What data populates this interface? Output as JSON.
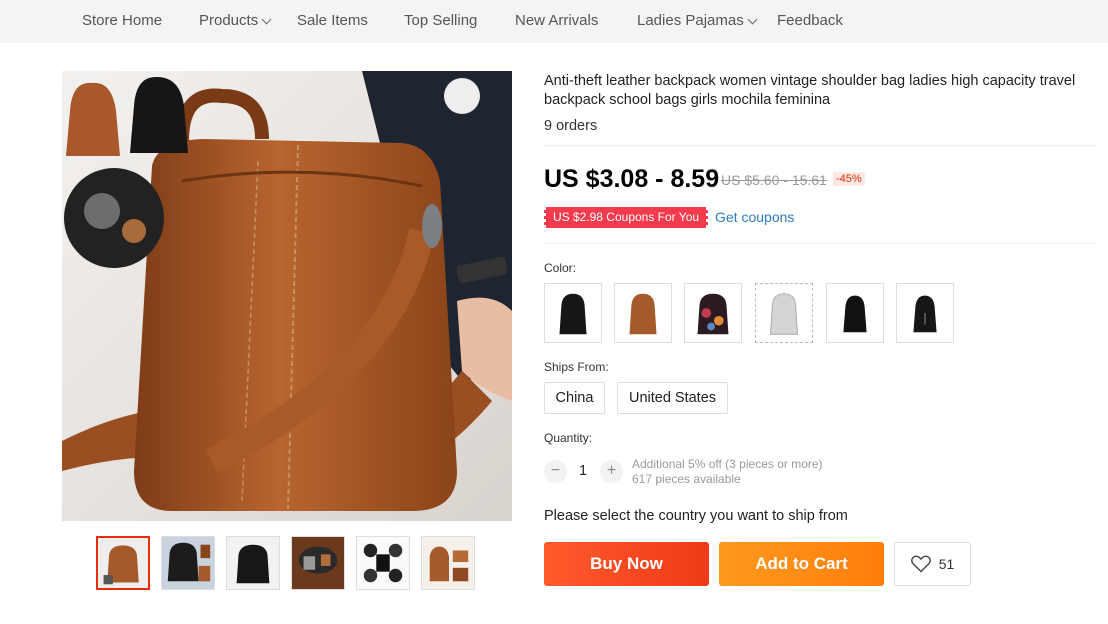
{
  "nav": {
    "items": [
      {
        "label": "Store Home",
        "dropdown": false
      },
      {
        "label": "Products",
        "dropdown": true
      },
      {
        "label": "Sale Items",
        "dropdown": false
      },
      {
        "label": "Top Selling",
        "dropdown": false
      },
      {
        "label": "New Arrivals",
        "dropdown": false
      },
      {
        "label": "Ladies Pajamas",
        "dropdown": true
      },
      {
        "label": "Feedback",
        "dropdown": false
      }
    ]
  },
  "product": {
    "title": "Anti-theft leather backpack women vintage shoulder bag ladies high capacity travel backpack school bags girls mochila feminina",
    "orders": "9 orders",
    "price": "US $3.08 - 8.59",
    "original_price": "US $5.60 - 15.61",
    "discount": "-45%",
    "coupon_tag": "US $2.98 Coupons For You",
    "get_coupons": "Get coupons"
  },
  "options": {
    "color_label": "Color:",
    "colors": [
      "black",
      "brown",
      "floral",
      "silver",
      "black-small",
      "black-tassel"
    ],
    "ships_from_label": "Ships From:",
    "ships_from": [
      "China",
      "United States"
    ],
    "quantity_label": "Quantity:",
    "quantity_value": "1",
    "minus": "−",
    "plus": "+",
    "qty_note_1": "Additional 5% off (3 pieces or more)",
    "qty_note_2": "617 pieces available"
  },
  "actions": {
    "ship_note": "Please select the country you want to ship from",
    "buy_now": "Buy Now",
    "add_to_cart": "Add to Cart",
    "wishlist_count": "51"
  },
  "gallery": {
    "thumbnails": [
      "brown-bag",
      "blue-black-bag",
      "black-bag",
      "brown-interior",
      "black-detail",
      "brown-set"
    ],
    "active_index": 0
  },
  "colors": {
    "accent": "#e62e04",
    "buy": "#f03a17",
    "cart": "#ff8a14",
    "coupon": "#f43b4e",
    "link": "#2e7dbf",
    "bag_brown": "#a55a2b"
  }
}
